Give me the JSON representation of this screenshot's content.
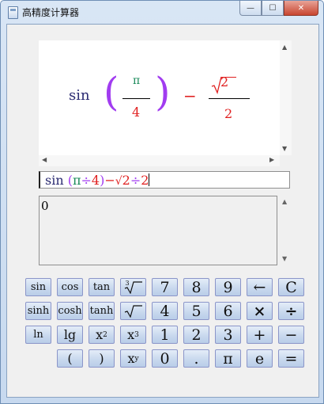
{
  "window": {
    "title": "高精度计算器",
    "controls": {
      "minimize": "—",
      "maximize": "☐",
      "close": "✕"
    }
  },
  "formula_display": {
    "func": "sin",
    "left_paren": "(",
    "right_paren": ")",
    "numerator": "π",
    "denominator": "4",
    "operator": "−",
    "numerator2": "2",
    "denominator2": "2"
  },
  "expression": {
    "parts": [
      "sin",
      " (",
      "π",
      "÷",
      "4",
      ")",
      "−",
      "2",
      "÷",
      "2"
    ]
  },
  "result": {
    "value": "0"
  },
  "keypad": {
    "row1": [
      "sin",
      "cos",
      "tan",
      "",
      "7",
      "8",
      "9",
      "←",
      "C"
    ],
    "row2": [
      "sinh",
      "cosh",
      "tanh",
      "",
      "4",
      "5",
      "6",
      "×",
      "÷"
    ],
    "row3": [
      "ln",
      "lg",
      "x",
      "x",
      "1",
      "2",
      "3",
      "+",
      "−"
    ],
    "row4": [
      "(",
      ")",
      "x",
      "0",
      ".",
      "π",
      "e",
      "="
    ],
    "cube_root_index": "3",
    "square_sup": "2",
    "cube_sup": "3",
    "power_sup": "y"
  },
  "colors": {
    "function": "#2b2b72",
    "paren": "#a13cf0",
    "pi": "#1a8a5a",
    "number": "#e02020",
    "key_border": "#8b95c9"
  }
}
